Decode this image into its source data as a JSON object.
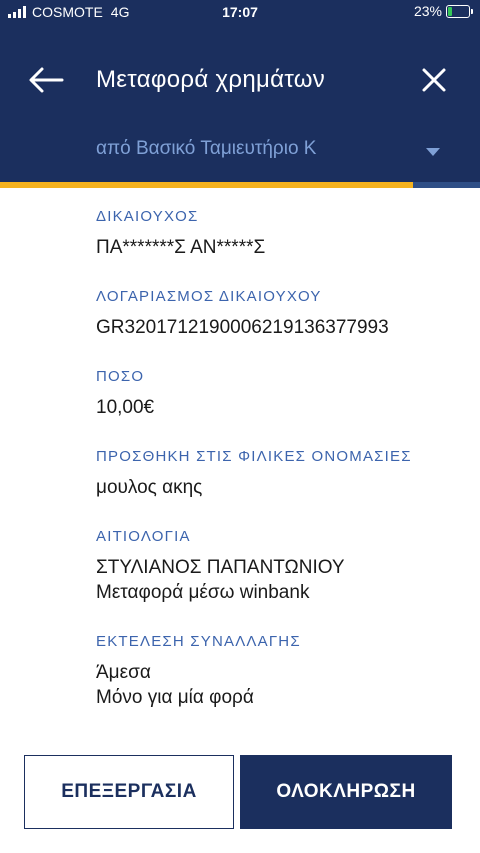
{
  "status_bar": {
    "carrier": "COSMOTE",
    "network": "4G",
    "time": "17:07",
    "battery_percent": "23%",
    "battery_level": 0.23,
    "charging": true
  },
  "header": {
    "title": "Μεταφορά χρημάτων",
    "from_account": "από Βασικό Ταμιευτήριο Κ",
    "progress": 0.86,
    "colors": {
      "background": "#1b2f5e",
      "accent": "#f5b21e",
      "account_text": "#7fa0d6"
    }
  },
  "fields": [
    {
      "label": "ΔΙΚΑΙΟΥΧΟΣ",
      "lines": [
        "ΠΑ*******Σ ΑΝ*****Σ"
      ]
    },
    {
      "label": "ΛΟΓΑΡΙΑΣΜΟΣ ΔΙΚΑΙΟΥΧΟΥ",
      "lines": [
        "GR3201712190006219136377993"
      ]
    },
    {
      "label": "ΠΟΣΟ",
      "lines": [
        "10,00€"
      ]
    },
    {
      "label": "ΠΡΟΣΘΗΚΗ ΣΤΙΣ ΦΙΛΙΚΕΣ ΟΝΟΜΑΣΙΕΣ",
      "lines": [
        "μουλος ακης"
      ]
    },
    {
      "label": "ΑΙΤΙΟΛΟΓΙΑ",
      "lines": [
        "ΣΤΥΛΙΑΝΟΣ ΠΑΠΑΝΤΩΝΙΟΥ",
        "Μεταφορά μέσω winbank"
      ]
    },
    {
      "label": "ΕΚΤΕΛΕΣΗ ΣΥΝΑΛΛΑΓΗΣ",
      "lines": [
        "Άμεσα",
        "Μόνο για μία φορά"
      ]
    }
  ],
  "buttons": {
    "edit": "ΕΠΕΞΕΡΓΑΣΙΑ",
    "complete": "ΟΛΟΚΛΗΡΩΣΗ"
  },
  "icons": {
    "back": "arrow-left-icon",
    "close": "close-icon",
    "dropdown": "caret-down-icon",
    "signal": "signal-icon",
    "battery": "battery-charging-icon"
  }
}
